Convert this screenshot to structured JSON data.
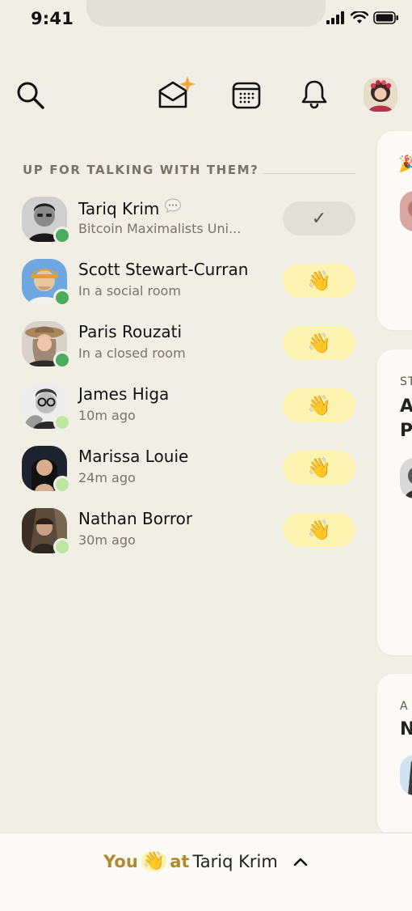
{
  "status_bar": {
    "time": "9:41"
  },
  "nav": {
    "icons": [
      "search-icon",
      "envelope-sparkle-icon",
      "calendar-icon",
      "bell-icon"
    ],
    "accent": "#F2A93B"
  },
  "section": {
    "title": "UP FOR TALKING WITH THEM?"
  },
  "people": [
    {
      "name": "Tariq Krim",
      "status": "Bitcoin Maximalists Uni...",
      "presence": "active",
      "waved": true,
      "has_chat": true
    },
    {
      "name": "Scott Stewart-Curran",
      "status": "In a social room",
      "presence": "active",
      "waved": false
    },
    {
      "name": "Paris Rouzati",
      "status": "In a closed room",
      "presence": "active",
      "waved": false
    },
    {
      "name": "James Higa",
      "status": "10m ago",
      "presence": "recent",
      "waved": false
    },
    {
      "name": "Marissa Louie",
      "status": "24m ago",
      "presence": "recent",
      "waved": false
    },
    {
      "name": "Nathan Borror",
      "status": "30m ago",
      "presence": "recent",
      "waved": false
    }
  ],
  "wave_button": {
    "done_label": "✓",
    "wave_label": "👋"
  },
  "right_cards": {
    "card1": {
      "emoji": "🎉"
    },
    "card2": {
      "small": "ST",
      "line1": "A",
      "line2": "P"
    },
    "card3": {
      "small": "A",
      "line1": "N"
    }
  },
  "bottom": {
    "you": "You",
    "wave": "👋",
    "at": "at",
    "target": "Tariq Krim"
  },
  "colors": {
    "background": "#F1EFE5",
    "wave_bg": "#FDF3B1",
    "active": "#4CAA5E",
    "recent": "#BDE6A2",
    "muted": "#7A7466",
    "accent_text": "#B08A2D"
  }
}
